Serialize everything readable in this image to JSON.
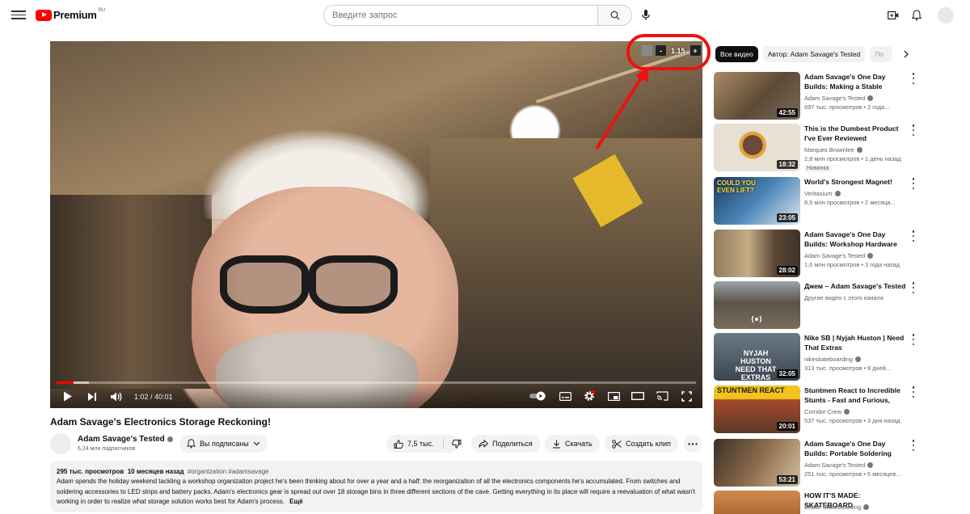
{
  "header": {
    "logo_text": "Premium",
    "logo_region": "RU",
    "search_placeholder": "Введите запрос"
  },
  "player": {
    "time": "1:02 / 40:01",
    "speed_value": "1.15",
    "speed_minus": "-",
    "speed_plus": "+",
    "progress_fraction": 0.026,
    "buffer_fraction": 0.05
  },
  "video": {
    "title": "Adam Savage's Electronics Storage Reckoning!",
    "channel": "Adam Savage's Tested",
    "subscribers": "6,24 млн подписчиков",
    "subscribed_label": "Вы подписаны",
    "likes": "7,5 тыс.",
    "share": "Поделиться",
    "download": "Скачать",
    "clip": "Создать клип"
  },
  "description": {
    "views": "295 тыс. просмотров",
    "date": "10 месяцев назад",
    "tags": "#organization #adamsavage",
    "text": "Adam spends the holiday weekend tackling a workshop organization project he's been thinking about for over a year and a half: the reorganization of all the electronics components he's accumulated. From switches and soldering accessories to LED strips and battery packs, Adam's electronics gear is spread out over 18 storage bins in three different sections of the cave. Getting everything in its place will require a reevaluation of what wasn't working in order to realize what storage solution works best for Adam's process.",
    "more": "Ещё"
  },
  "chips": [
    "Все видео",
    "Автор: Adam Savage's Tested",
    "По"
  ],
  "recommendations": [
    {
      "title": "Adam Savage's One Day Builds: Making a Stable Workbench!",
      "channel": "Adam Savage's Tested",
      "meta": "697 тыс. просмотров • 2 года...",
      "duration": "42:55",
      "badge": "",
      "color": "#6b5a46"
    },
    {
      "title": "This is the Dumbest Product I've Ever Reviewed",
      "channel": "Marques Brownlee",
      "meta": "2,8 млн просмотров • 1 день назад",
      "duration": "18:32",
      "badge": "Новинка",
      "color": "#c9b48c"
    },
    {
      "title": "World's Strongest Magnet!",
      "channel": "Veritasium",
      "meta": "8,5 млн просмотров • 2 месяца...",
      "duration": "23:05",
      "badge": "",
      "color": "#2f5d8a"
    },
    {
      "title": "Adam Savage's One Day Builds: Workshop Hardware Storage!",
      "channel": "Adam Savage's Tested",
      "meta": "1,6 млн просмотров • 3 года назад",
      "duration": "28:02",
      "badge": "",
      "color": "#7a6048"
    },
    {
      "title": "Джем – Adam Savage's Tested",
      "channel": "Другие видео с этого канала",
      "meta": "",
      "duration": "",
      "badge": "",
      "color": "#55606a"
    },
    {
      "title": "Nike SB | Nyjah Huston | Need That Extras",
      "channel": "nikeskateboarding",
      "meta": "313 тыс. просмотров • 8 дней...",
      "duration": "32:05",
      "badge": "",
      "color": "#4a5661"
    },
    {
      "title": "Stuntmen React to Incredible Stunts - Fast and Furious, Day...",
      "channel": "Corridor Crew",
      "meta": "537 тыс. просмотров • 3 дня назад",
      "duration": "20:01",
      "badge": "",
      "color": "#d89a2a"
    },
    {
      "title": "Adam Savage's One Day Builds: Portable Soldering Station...",
      "channel": "Adam Savage's Tested",
      "meta": "251 тыс. просмотров • 5 месяцев...",
      "duration": "53:21",
      "badge": "",
      "color": "#6a5440"
    },
    {
      "title": "HOW IT'S MADE: SKATEBOARD",
      "channel": "Braille Skateboarding",
      "meta": "",
      "duration": "",
      "badge": "",
      "color": "#b56a3a"
    }
  ],
  "thumb_texts": {
    "r2": "COULD YOU EVEN LIFT?",
    "r5": "NYJAH HUSTON NEED THAT EXTRAS",
    "r6": "STUNTMEN REACT"
  }
}
